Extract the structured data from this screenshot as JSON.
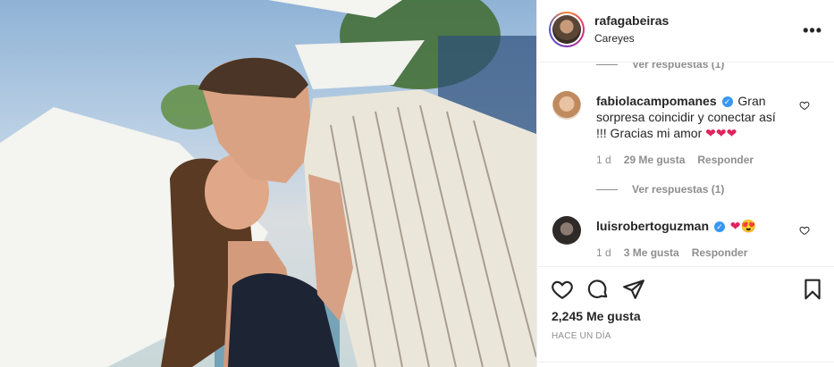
{
  "post": {
    "username": "rafagabeiras",
    "location": "Careyes",
    "more_label": "•••",
    "likes_count": "2,245",
    "likes_label": "Me gusta",
    "time_ago": "HACE UN DÍA"
  },
  "comments": [
    {
      "replies_link": "Ver respuestas (1)"
    },
    {
      "user": "fabiolacampomanes",
      "verified": true,
      "text": "Gran sorpresa coincidir y conectar así !!! Gracias mi amor",
      "emoji": "❤❤❤",
      "age": "1 d",
      "likes": "29 Me gusta",
      "reply_label": "Responder",
      "replies_link": "Ver respuestas (1)"
    },
    {
      "user": "luisrobertoguzman",
      "verified": true,
      "emoji": "❤😍",
      "age": "1 d",
      "likes": "3 Me gusta",
      "reply_label": "Responder"
    }
  ],
  "icons": {
    "like": "heart-outline-icon",
    "comment": "comment-bubble-icon",
    "share": "paper-plane-icon",
    "save": "bookmark-icon",
    "verified": "verified-badge-icon"
  },
  "colors": {
    "verified_blue": "#3897f0",
    "muted_text": "#8e8e8e",
    "primary_text": "#262626"
  }
}
